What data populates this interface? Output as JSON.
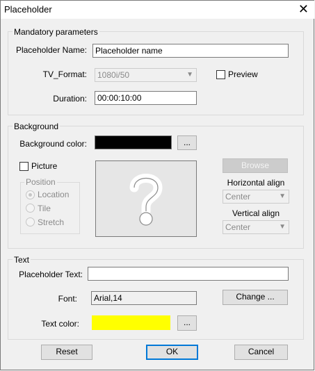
{
  "window": {
    "title": "Placeholder",
    "close_glyph": "✕"
  },
  "mandatory": {
    "legend": "Mandatory parameters",
    "name_label": "Placeholder Name:",
    "name_value": "Placeholder name",
    "format_label": "TV_Format:",
    "format_value": "1080i/50",
    "preview_label": "Preview",
    "duration_label": "Duration:",
    "duration_value": "00:00:10:00"
  },
  "background": {
    "legend": "Background",
    "color_label": "Background color:",
    "color": "#000000",
    "ellipsis": "...",
    "picture_label": "Picture",
    "browse_label": "Browse",
    "position_legend": "Position",
    "position_options": [
      "Location",
      "Tile",
      "Stretch"
    ],
    "halign_label": "Horizontal align",
    "halign_value": "Center",
    "valign_label": "Vertical align",
    "valign_value": "Center"
  },
  "text": {
    "legend": "Text",
    "placeholder_label": "Placeholder Text:",
    "placeholder_value": "",
    "font_label": "Font:",
    "font_value": "Arial,14",
    "change_label": "Change ...",
    "color_label": "Text color:",
    "color": "#ffff00",
    "ellipsis": "..."
  },
  "footer": {
    "reset_label": "Reset",
    "ok_label": "OK",
    "cancel_label": "Cancel"
  }
}
